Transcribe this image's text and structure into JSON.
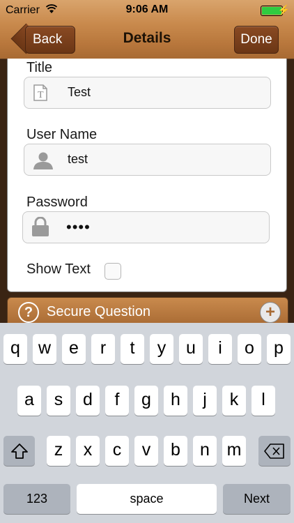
{
  "status_bar": {
    "carrier": "Carrier",
    "time": "9:06 AM",
    "battery_level": 1.0
  },
  "nav": {
    "back_label": "Back",
    "title": "Details",
    "done_label": "Done"
  },
  "form": {
    "title_label": "Title",
    "title_value": "Test",
    "username_label": "User Name",
    "username_value": "test",
    "password_label": "Password",
    "password_value": "••••",
    "show_text_label": "Show Text",
    "show_text_checked": false
  },
  "secure_question": {
    "label": "Secure Question",
    "question_icon": "?",
    "add_icon": "+"
  },
  "keyboard": {
    "row1": [
      "q",
      "w",
      "e",
      "r",
      "t",
      "y",
      "u",
      "i",
      "o",
      "p"
    ],
    "row2": [
      "a",
      "s",
      "d",
      "f",
      "g",
      "h",
      "j",
      "k",
      "l"
    ],
    "row3": [
      "z",
      "x",
      "c",
      "v",
      "b",
      "n",
      "m"
    ],
    "numbers_label": "123",
    "space_label": "space",
    "next_label": "Next"
  },
  "colors": {
    "nav_wood": "#c98a4d",
    "button_brown": "#7a3f1c",
    "keyboard_bg": "#d1d5db"
  }
}
